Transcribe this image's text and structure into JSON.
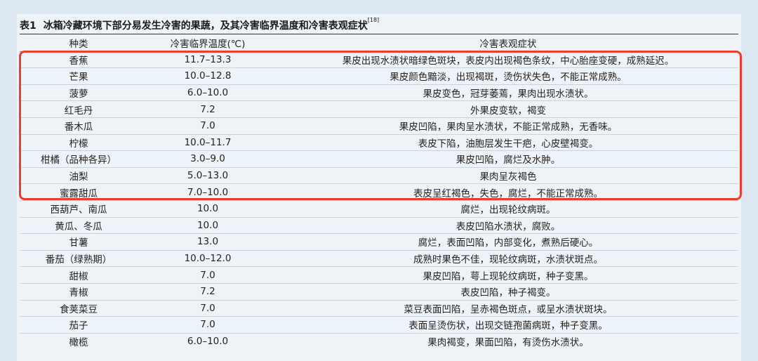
{
  "caption": {
    "table_no": "表1",
    "title": "冰箱冷藏环境下部分易发生冷害的果蔬，及其冷害临界温度和冷害表观症状",
    "ref": "[18]"
  },
  "headers": [
    "种类",
    "冷害临界温度(℃)",
    "冷害表观症状"
  ],
  "rows": [
    [
      "香蕉",
      "11.7–13.3",
      "果皮出现水渍状暗绿色斑块，表皮内出现褐色条纹，中心胎座变硬，成熟延迟。"
    ],
    [
      "芒果",
      "10.0–12.8",
      "果皮颜色黯淡，出现褐斑，烫伤状失色，不能正常成熟。"
    ],
    [
      "菠萝",
      "6.0–10.0",
      "果皮变色，冠芽萎蔫，果肉出现水渍状。"
    ],
    [
      "红毛丹",
      "7.2",
      "外果皮变软，褐变"
    ],
    [
      "番木瓜",
      "7.0",
      "果皮凹陷，果肉呈水渍状，不能正常成熟，无香味。"
    ],
    [
      "柠檬",
      "10.0–11.7",
      "表皮下陷，油胞层发生干疤，心皮壁褐变。"
    ],
    [
      "柑橘（品种各异）",
      "3.0–9.0",
      "果皮凹陷，腐烂及水肿。"
    ],
    [
      "油梨",
      "5.0–13.0",
      "果肉呈灰褐色"
    ],
    [
      "蜜露甜瓜",
      "7.0–10.0",
      "表皮呈红褐色，失色，腐烂，不能正常成熟。"
    ],
    [
      "西葫芦、南瓜",
      "10.0",
      "腐烂，出现轮纹病斑。"
    ],
    [
      "黄瓜、冬瓜",
      "10.0",
      "表皮凹陷水渍状，腐败。"
    ],
    [
      "甘薯",
      "13.0",
      "腐烂，表面凹陷，内部变化，煮熟后硬心。"
    ],
    [
      "番茄（绿熟期）",
      "10.0–12.0",
      "成熟时果色不佳，现轮纹病斑，水渍状斑点。"
    ],
    [
      "甜椒",
      "7.0",
      "果皮凹陷，萼上现轮纹病斑，种子变黑。"
    ],
    [
      "青椒",
      "7.2",
      "表皮凹陷，种子褐变。"
    ],
    [
      "食荚菜豆",
      "7.0",
      "菜豆表面凹陷，呈赤褐色斑点，或呈水渍状斑块。"
    ],
    [
      "茄子",
      "7.0",
      "表面呈烫伤状，出现交链孢菌病斑，种子变黑。"
    ],
    [
      "橄榄",
      "6.0–10.0",
      "果肉褐变，果面凹陷，有烫伤水渍状。"
    ]
  ],
  "colors": {
    "page_bg": "#dde7f1",
    "table_bg": "#eef3f8",
    "highlight_border": "#e8402c"
  }
}
